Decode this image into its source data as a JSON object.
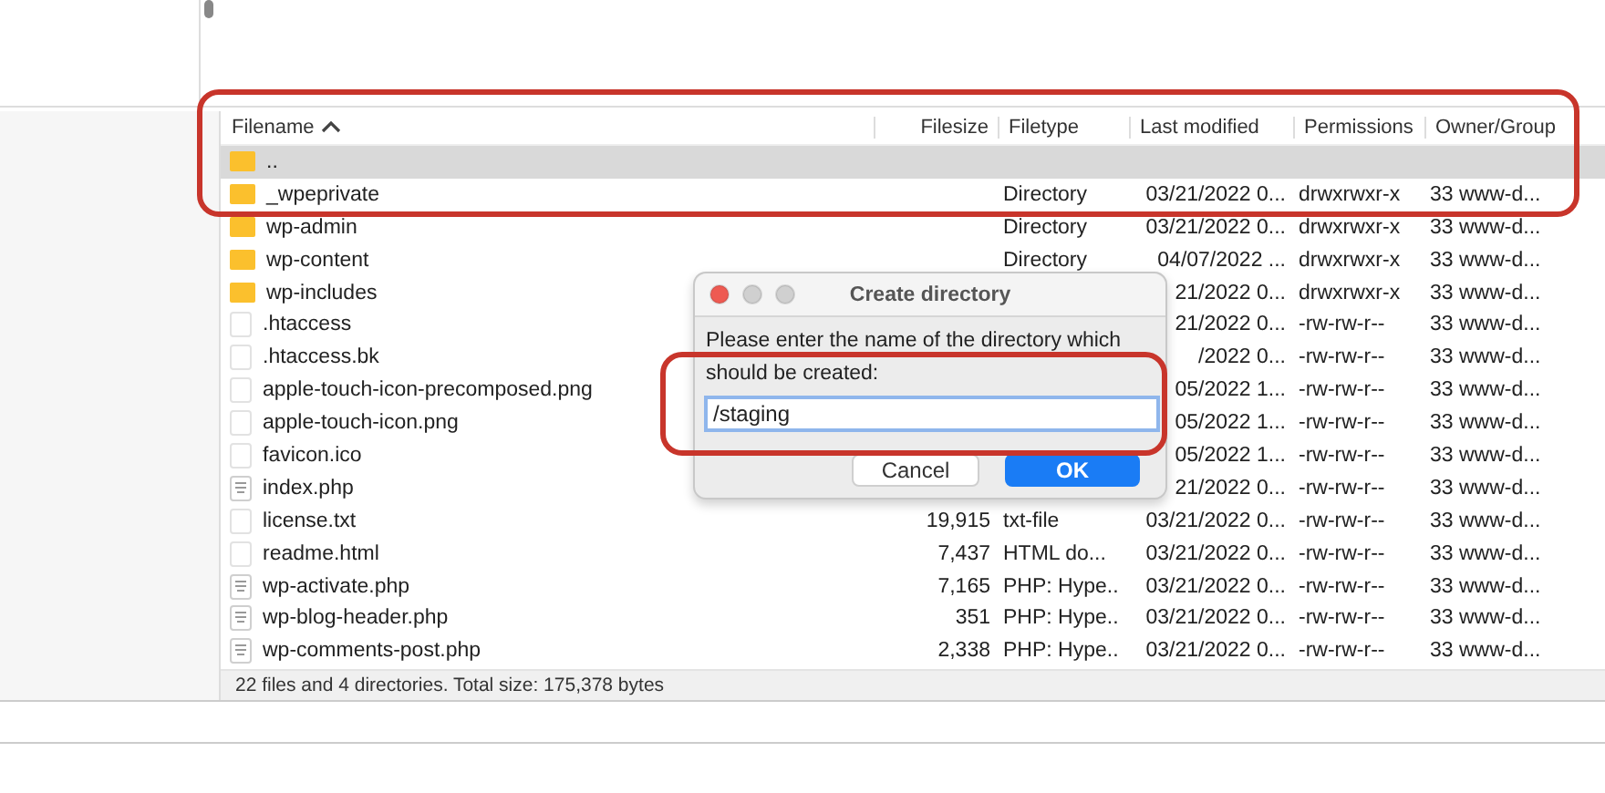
{
  "file_list": {
    "columns": [
      {
        "label": "Filename",
        "sorted": true
      },
      {
        "label": "Filesize",
        "sorted": false
      },
      {
        "label": "Filetype",
        "sorted": false
      },
      {
        "label": "Last modified",
        "sorted": false
      },
      {
        "label": "Permissions",
        "sorted": false
      },
      {
        "label": "Owner/Group",
        "sorted": false
      }
    ],
    "rows": [
      {
        "kind": "folder",
        "name": "..",
        "selected": true
      },
      {
        "kind": "folder",
        "name": "_wpeprivate",
        "filetype": "Directory",
        "last_modified": "03/21/2022 0...",
        "permissions": "drwxrwxr-x",
        "owner": "33 www-d...",
        "selected": false
      },
      {
        "kind": "folder",
        "name": "wp-admin",
        "filetype": "Directory",
        "last_modified": "03/21/2022 0...",
        "permissions": "drwxrwxr-x",
        "owner": "33 www-d...",
        "selected": false
      },
      {
        "kind": "folder",
        "name": "wp-content",
        "filetype": "Directory",
        "last_modified": "04/07/2022 ...",
        "permissions": "drwxrwxr-x",
        "owner": "33 www-d...",
        "selected": false
      },
      {
        "kind": "folder",
        "name": "wp-includes",
        "last_modified": "21/2022 0...",
        "permissions": "drwxrwxr-x",
        "owner": "33 www-d...",
        "selected": false
      },
      {
        "kind": "file",
        "name": ".htaccess",
        "last_modified": "21/2022 0...",
        "permissions": "-rw-rw-r--",
        "owner": "33 www-d...",
        "selected": false
      },
      {
        "kind": "file",
        "name": ".htaccess.bk",
        "last_modified": "/2022 0...",
        "permissions": "-rw-rw-r--",
        "owner": "33 www-d...",
        "selected": false
      },
      {
        "kind": "file",
        "name": "apple-touch-icon-precomposed.png",
        "last_modified": "05/2022 1...",
        "permissions": "-rw-rw-r--",
        "owner": "33 www-d...",
        "selected": false
      },
      {
        "kind": "file",
        "name": "apple-touch-icon.png",
        "last_modified": "05/2022 1...",
        "permissions": "-rw-rw-r--",
        "owner": "33 www-d...",
        "selected": false
      },
      {
        "kind": "file",
        "name": "favicon.ico",
        "last_modified": "05/2022 1...",
        "permissions": "-rw-rw-r--",
        "owner": "33 www-d...",
        "selected": false
      },
      {
        "kind": "php",
        "name": "index.php",
        "last_modified": "21/2022 0...",
        "permissions": "-rw-rw-r--",
        "owner": "33 www-d...",
        "selected": false
      },
      {
        "kind": "file",
        "name": "license.txt",
        "filesize": "19,915",
        "filetype": "txt-file",
        "last_modified": "03/21/2022 0...",
        "permissions": "-rw-rw-r--",
        "owner": "33 www-d...",
        "selected": false
      },
      {
        "kind": "file",
        "name": "readme.html",
        "filesize": "7,437",
        "filetype": "HTML do...",
        "last_modified": "03/21/2022 0...",
        "permissions": "-rw-rw-r--",
        "owner": "33 www-d...",
        "selected": false
      },
      {
        "kind": "php",
        "name": "wp-activate.php",
        "filesize": "7,165",
        "filetype": "PHP: Hype..",
        "last_modified": "03/21/2022 0...",
        "permissions": "-rw-rw-r--",
        "owner": "33 www-d...",
        "selected": false
      },
      {
        "kind": "php",
        "name": "wp-blog-header.php",
        "filesize": "351",
        "filetype": "PHP: Hype..",
        "last_modified": "03/21/2022 0...",
        "permissions": "-rw-rw-r--",
        "owner": "33 www-d...",
        "selected": false
      },
      {
        "kind": "php",
        "name": "wp-comments-post.php",
        "filesize": "2,338",
        "filetype": "PHP: Hype..",
        "last_modified": "03/21/2022 0...",
        "permissions": "-rw-rw-r--",
        "owner": "33 www-d...",
        "selected": false
      }
    ]
  },
  "status_bar": "22 files and 4 directories. Total size: 175,378 bytes",
  "dialog": {
    "title": "Create directory",
    "message": "Please enter the name of the directory which should be created:",
    "value": "/staging",
    "buttons": [
      {
        "label": "Cancel",
        "default": false
      },
      {
        "label": "OK",
        "default": true
      }
    ]
  }
}
